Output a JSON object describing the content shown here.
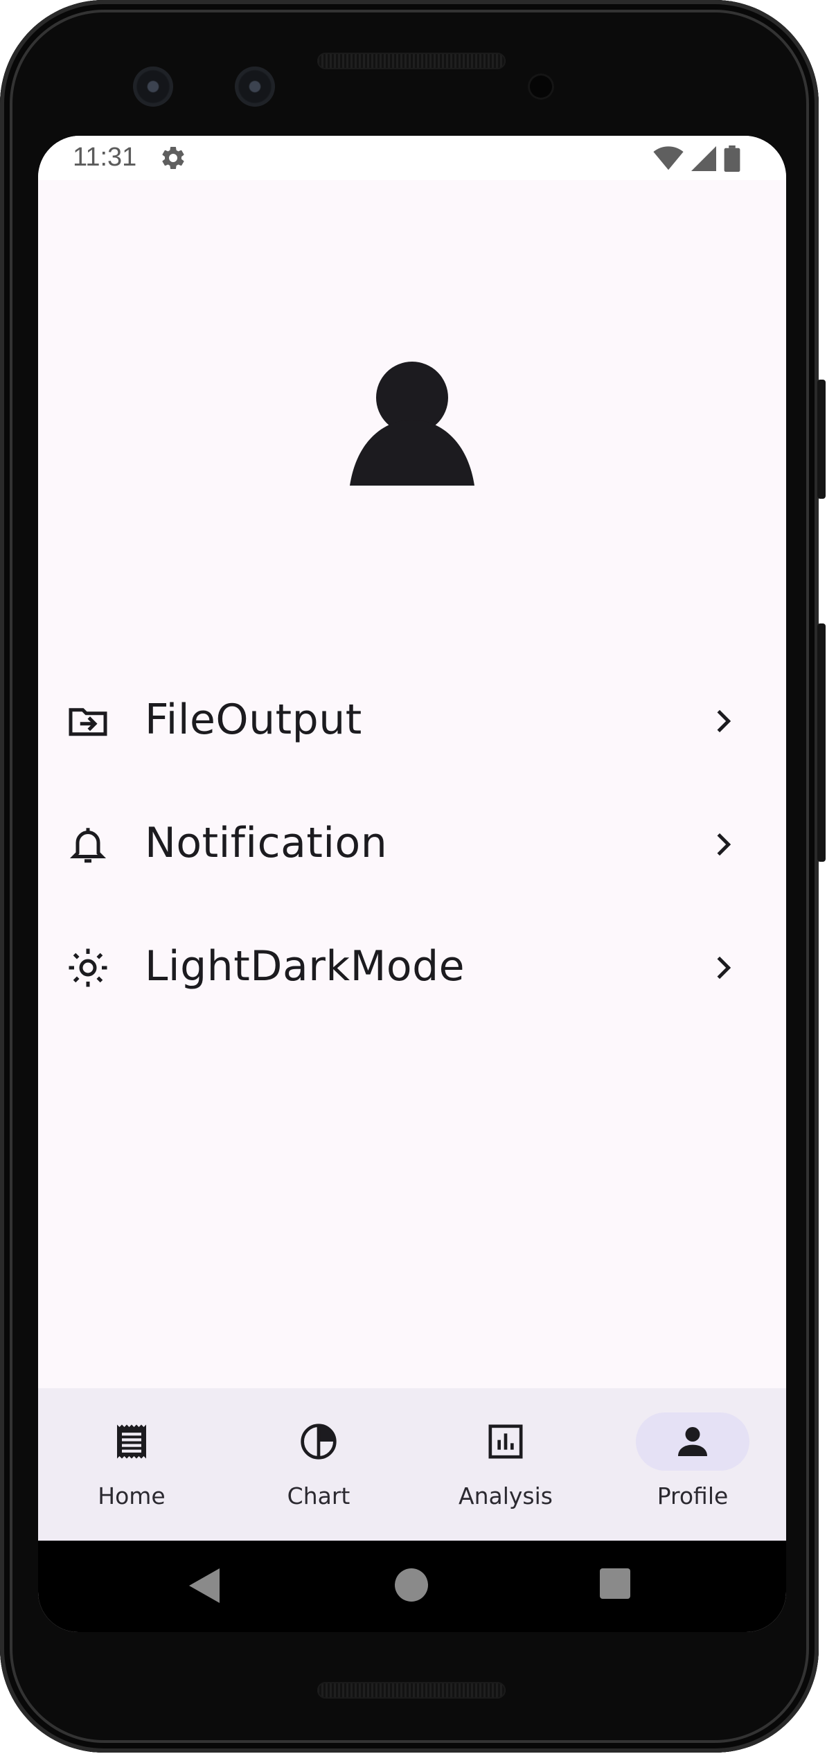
{
  "status_bar": {
    "time": "11:31",
    "icons": [
      "gear-icon",
      "wifi-icon",
      "signal-icon",
      "battery-icon"
    ]
  },
  "profile": {
    "avatar_icon": "person-icon"
  },
  "menu": {
    "items": [
      {
        "label": "FileOutput",
        "icon": "folder-export-icon"
      },
      {
        "label": "Notification",
        "icon": "bell-icon"
      },
      {
        "label": "LightDarkMode",
        "icon": "sun-icon"
      }
    ]
  },
  "bottom_nav": {
    "items": [
      {
        "label": "Home",
        "icon": "receipt-icon",
        "active": false
      },
      {
        "label": "Chart",
        "icon": "pie-chart-icon",
        "active": false
      },
      {
        "label": "Analysis",
        "icon": "bar-chart-icon",
        "active": false
      },
      {
        "label": "Profile",
        "icon": "person-icon",
        "active": true
      }
    ]
  },
  "system_nav": {
    "buttons": [
      "back-icon",
      "home-circle-icon",
      "recents-icon"
    ]
  },
  "colors": {
    "background": "#fdf8fc",
    "nav_background": "#f0ecf4",
    "active_indicator": "#e5e1f5",
    "text_primary": "#1c1b1f"
  }
}
